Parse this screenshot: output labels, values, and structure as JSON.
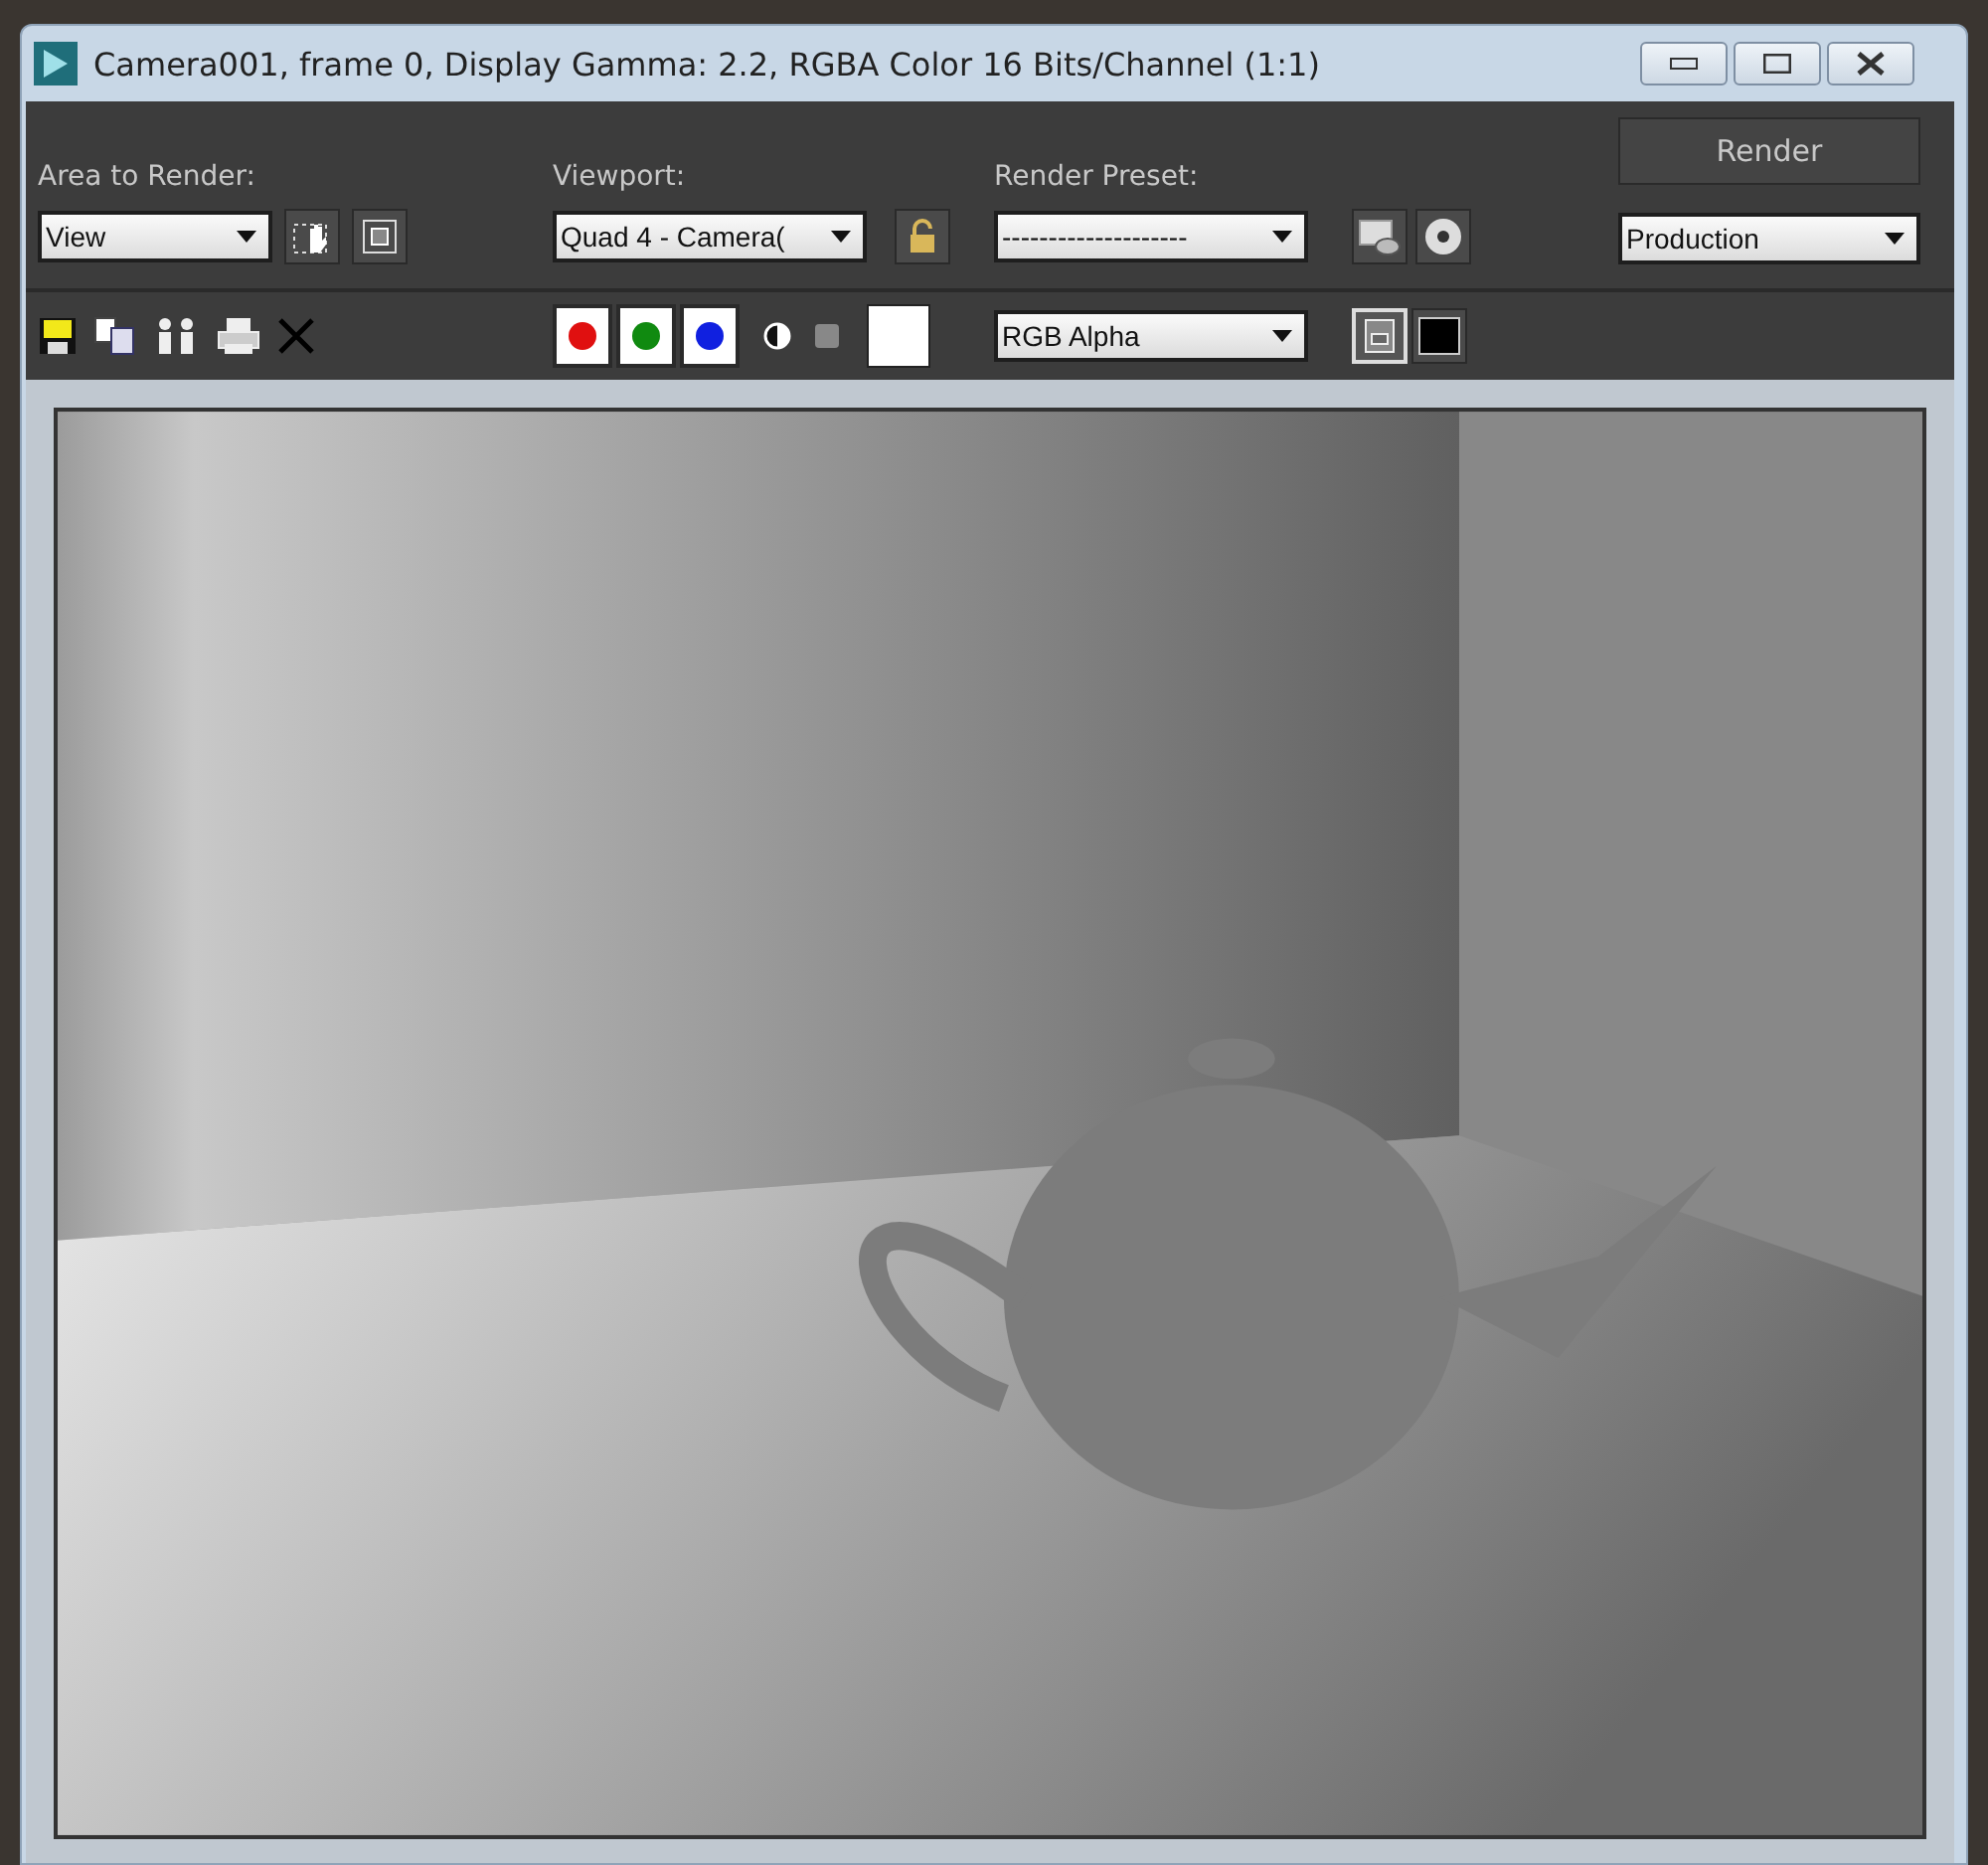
{
  "window": {
    "title": "Camera001, frame 0, Display Gamma: 2.2, RGBA Color 16 Bits/Channel (1:1)"
  },
  "area_to_render": {
    "label": "Area to Render:",
    "value": "View"
  },
  "viewport": {
    "label": "Viewport:",
    "value": "Quad 4 - Camera("
  },
  "render_preset": {
    "label": "Render Preset:",
    "value": "--------------------"
  },
  "render_button": {
    "label": "Render"
  },
  "render_mode": {
    "value": "Production"
  },
  "channels": [
    {
      "color": "#e01010",
      "on": true
    },
    {
      "color": "#108a10",
      "on": true
    },
    {
      "color": "#1020e0",
      "on": true
    }
  ],
  "channel_display": {
    "value": "RGB Alpha"
  }
}
